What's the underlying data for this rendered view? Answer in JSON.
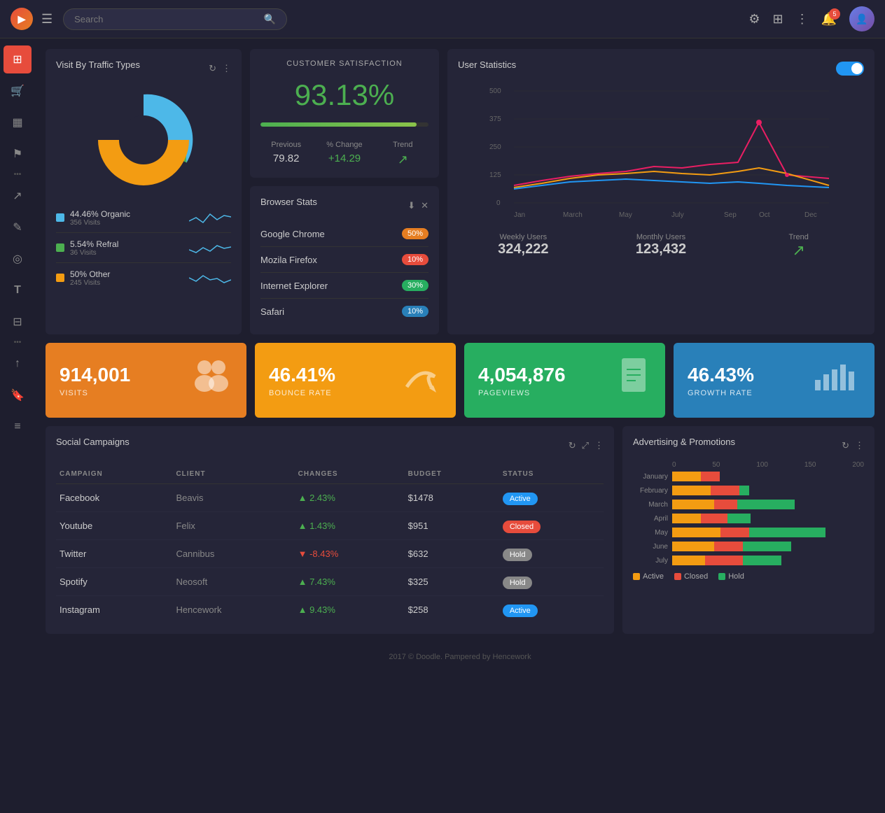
{
  "navbar": {
    "search_placeholder": "Search",
    "notification_count": "5",
    "hamburger_label": "☰",
    "logo_letter": "▶"
  },
  "sidebar": {
    "items": [
      {
        "name": "dashboard",
        "icon": "⊞",
        "active": true
      },
      {
        "name": "shopping",
        "icon": "🛒",
        "active": false
      },
      {
        "name": "grid",
        "icon": "▦",
        "active": false
      },
      {
        "name": "flag",
        "icon": "⚑",
        "active": false
      },
      {
        "name": "login",
        "icon": "↗",
        "active": false
      },
      {
        "name": "edit",
        "icon": "✎",
        "active": false
      },
      {
        "name": "circle",
        "icon": "◎",
        "active": false
      },
      {
        "name": "text",
        "icon": "T",
        "active": false
      },
      {
        "name": "layers",
        "icon": "⊟",
        "active": false
      },
      {
        "name": "upload",
        "icon": "↑",
        "active": false
      },
      {
        "name": "bookmark",
        "icon": "🔖",
        "active": false
      },
      {
        "name": "filter",
        "icon": "≡",
        "active": false
      }
    ]
  },
  "traffic_card": {
    "title": "Visit By Traffic Types",
    "segments": [
      {
        "label": "44.46% Organic",
        "count": "356 Visits",
        "color": "#4db8e8",
        "pct": 44.46
      },
      {
        "label": "5.54% Refral",
        "count": "36 Visits",
        "color": "#4caf50",
        "pct": 5.54
      },
      {
        "label": "50% Other",
        "count": "245 Visits",
        "color": "#f39c12",
        "pct": 50
      }
    ]
  },
  "satisfaction_card": {
    "title": "CUSTOMER SATISFACTION",
    "percent": "93.13%",
    "progress": 93,
    "previous_label": "Previous",
    "previous_value": "79.82",
    "change_label": "% Change",
    "change_value": "+14.29",
    "trend_label": "Trend"
  },
  "browser_stats": {
    "title": "Browser Stats",
    "items": [
      {
        "name": "Google Chrome",
        "pct": "50%",
        "color": "badge-orange"
      },
      {
        "name": "Mozila Firefox",
        "pct": "10%",
        "color": "badge-red"
      },
      {
        "name": "Internet Explorer",
        "pct": "30%",
        "color": "badge-green"
      },
      {
        "name": "Safari",
        "pct": "10%",
        "color": "badge-blue"
      }
    ]
  },
  "user_stats": {
    "title": "User Statistics",
    "weekly_label": "Weekly Users",
    "weekly_value": "324,222",
    "monthly_label": "Monthly Users",
    "monthly_value": "123,432",
    "trend_label": "Trend",
    "x_axis": [
      "Jan",
      "March",
      "May",
      "July",
      "Sep",
      "Oct",
      "Dec"
    ],
    "y_axis": [
      500,
      375,
      250,
      125,
      0
    ]
  },
  "metrics": [
    {
      "value": "914,001",
      "label": "VISITS",
      "icon": "people",
      "bg": "metric-card-orange"
    },
    {
      "value": "46.41%",
      "label": "BOUNCE RATE",
      "icon": "refresh",
      "bg": "metric-card-yellow"
    },
    {
      "value": "4,054,876",
      "label": "PAGEVIEWS",
      "icon": "document",
      "bg": "metric-card-green"
    },
    {
      "value": "46.43%",
      "label": "GROWTH RATE",
      "icon": "chart",
      "bg": "metric-card-blue"
    }
  ],
  "social_campaigns": {
    "title": "Social Campaigns",
    "columns": [
      "CAMPAIGN",
      "CLIENT",
      "CHANGES",
      "BUDGET",
      "STATUS"
    ],
    "rows": [
      {
        "campaign": "Facebook",
        "client": "Beavis",
        "change": "+2.43%",
        "change_pos": true,
        "budget": "$1478",
        "status": "Active",
        "status_class": "status-active"
      },
      {
        "campaign": "Youtube",
        "client": "Felix",
        "change": "+1.43%",
        "change_pos": true,
        "budget": "$951",
        "status": "Closed",
        "status_class": "status-closed"
      },
      {
        "campaign": "Twitter",
        "client": "Cannibus",
        "change": "-8.43%",
        "change_pos": false,
        "budget": "$632",
        "status": "Hold",
        "status_class": "status-hold"
      },
      {
        "campaign": "Spotify",
        "client": "Neosoft",
        "change": "+7.43%",
        "change_pos": true,
        "budget": "$325",
        "status": "Hold",
        "status_class": "status-hold"
      },
      {
        "campaign": "Instagram",
        "client": "Hencework",
        "change": "+9.43%",
        "change_pos": true,
        "budget": "$258",
        "status": "Active",
        "status_class": "status-active"
      }
    ]
  },
  "advertising": {
    "title": "Advertising & Promotions",
    "months": [
      "January",
      "February",
      "March",
      "April",
      "May",
      "June",
      "July"
    ],
    "x_axis": [
      "0",
      "50",
      "100",
      "150",
      "200"
    ],
    "data": [
      {
        "active": 30,
        "closed": 20,
        "hold": 0
      },
      {
        "active": 40,
        "closed": 30,
        "hold": 10
      },
      {
        "active": 45,
        "closed": 25,
        "hold": 60
      },
      {
        "active": 30,
        "closed": 28,
        "hold": 25
      },
      {
        "active": 50,
        "closed": 30,
        "hold": 80
      },
      {
        "active": 45,
        "closed": 30,
        "hold": 50
      },
      {
        "active": 35,
        "closed": 40,
        "hold": 40
      }
    ],
    "legend": [
      {
        "label": "Active",
        "color": "bar-active"
      },
      {
        "label": "Closed",
        "color": "bar-closed"
      },
      {
        "label": "Hold",
        "color": "bar-hold"
      }
    ]
  },
  "footer": {
    "text": "2017 © Doodle. Pampered by Hencework"
  }
}
